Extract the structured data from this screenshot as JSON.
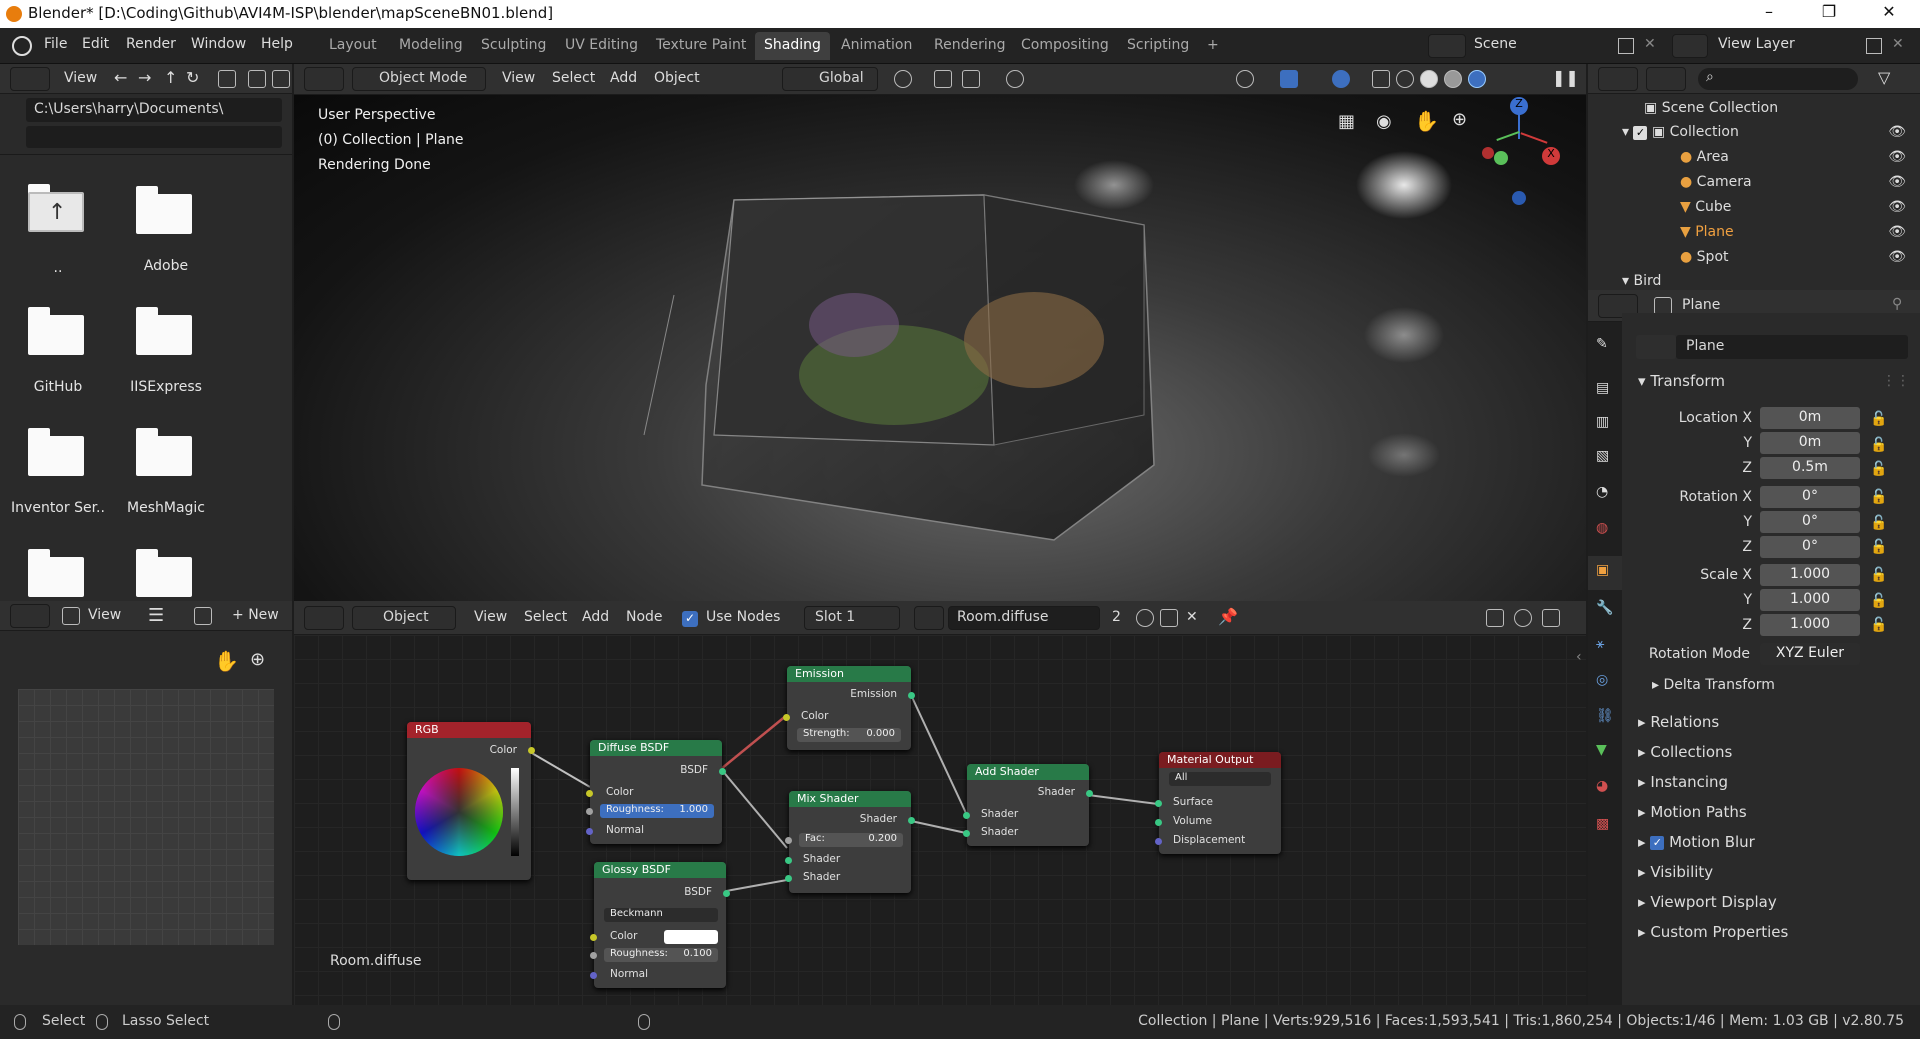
{
  "title": "Blender* [D:\\Coding\\Github\\AVI4M-ISP\\blender\\mapSceneBN01.blend]",
  "window_controls": [
    "–",
    "❐",
    "✕"
  ],
  "menus": [
    "File",
    "Edit",
    "Render",
    "Window",
    "Help"
  ],
  "workspaces": [
    "Layout",
    "Modeling",
    "Sculpting",
    "UV Editing",
    "Texture Paint",
    "Shading",
    "Animation",
    "Rendering",
    "Compositing",
    "Scripting",
    "+"
  ],
  "active_workspace": "Shading",
  "scene": "Scene",
  "view_layer": "View Layer",
  "file_browser": {
    "view_label": "View",
    "path": "C:\\Users\\harry\\Documents\\",
    "filter": "",
    "items": [
      "..",
      "Adobe",
      "GitHub",
      "IISExpress",
      "Inventor Ser..",
      "MeshMagic",
      "",
      ""
    ]
  },
  "viewport": {
    "mode": "Object Mode",
    "menus": [
      "View",
      "Select",
      "Add",
      "Object"
    ],
    "orientation": "Global",
    "info": [
      "User Perspective",
      "(0) Collection | Plane",
      "Rendering Done"
    ],
    "gizmo_axes": [
      "Z",
      "Y",
      "X"
    ]
  },
  "image_editor": {
    "view": "View",
    "new_label": "New"
  },
  "node_editor": {
    "type": "Object",
    "menus": [
      "View",
      "Select",
      "Add",
      "Node"
    ],
    "use_nodes_label": "Use Nodes",
    "use_nodes": true,
    "slot": "Slot 1",
    "material": "Room.diffuse",
    "users": "2",
    "material_label": "Room.diffuse",
    "nodes": {
      "rgb": {
        "title": "RGB",
        "out": "Color"
      },
      "diffuse": {
        "title": "Diffuse BSDF",
        "out": "BSDF",
        "color": "Color",
        "roughness_label": "Roughness:",
        "roughness": "1.000",
        "normal": "Normal"
      },
      "glossy": {
        "title": "Glossy BSDF",
        "out": "BSDF",
        "dist": "Beckmann",
        "color": "Color",
        "roughness_label": "Roughness:",
        "roughness": "0.100",
        "normal": "Normal"
      },
      "emission": {
        "title": "Emission",
        "out": "Emission",
        "color": "Color",
        "strength_label": "Strength:",
        "strength": "0.000"
      },
      "mix": {
        "title": "Mix Shader",
        "out": "Shader",
        "fac_label": "Fac:",
        "fac": "0.200",
        "in1": "Shader",
        "in2": "Shader"
      },
      "add": {
        "title": "Add Shader",
        "out": "Shader",
        "in1": "Shader",
        "in2": "Shader"
      },
      "output": {
        "title": "Material Output",
        "target": "All",
        "surface": "Surface",
        "volume": "Volume",
        "displacement": "Displacement"
      }
    }
  },
  "outliner": {
    "root": "Scene Collection",
    "collection": "Collection",
    "items": [
      "Area",
      "Camera",
      "Cube",
      "Plane",
      "Spot"
    ],
    "next": "Bird"
  },
  "properties": {
    "object": "Plane",
    "name_field": "Plane",
    "transform_label": "Transform",
    "location": {
      "label": "Location X",
      "x": "0m",
      "y": "0m",
      "z": "0.5m"
    },
    "rotation": {
      "label": "Rotation X",
      "x": "0°",
      "y": "0°",
      "z": "0°"
    },
    "scale": {
      "label": "Scale X",
      "x": "1.000",
      "y": "1.000",
      "z": "1.000"
    },
    "axis_y": "Y",
    "axis_z": "Z",
    "rotation_mode_label": "Rotation Mode",
    "rotation_mode": "XYZ Euler",
    "delta": "Delta Transform",
    "sections": [
      "Relations",
      "Collections",
      "Instancing",
      "Motion Paths",
      "Motion Blur",
      "Visibility",
      "Viewport Display",
      "Custom Properties"
    ]
  },
  "status": {
    "select": "Select",
    "lasso": "Lasso Select",
    "stats": "Collection | Plane | Verts:929,516 | Faces:1,593,541 | Tris:1,860,254 | Objects:1/46 | Mem: 1.03 GB | v2.80.75"
  },
  "colors": {
    "accent": "#3d6fbf",
    "orange": "#e87d0d",
    "node_green": "#287a48",
    "node_red": "#a3232b",
    "node_output": "#7a1c20"
  }
}
